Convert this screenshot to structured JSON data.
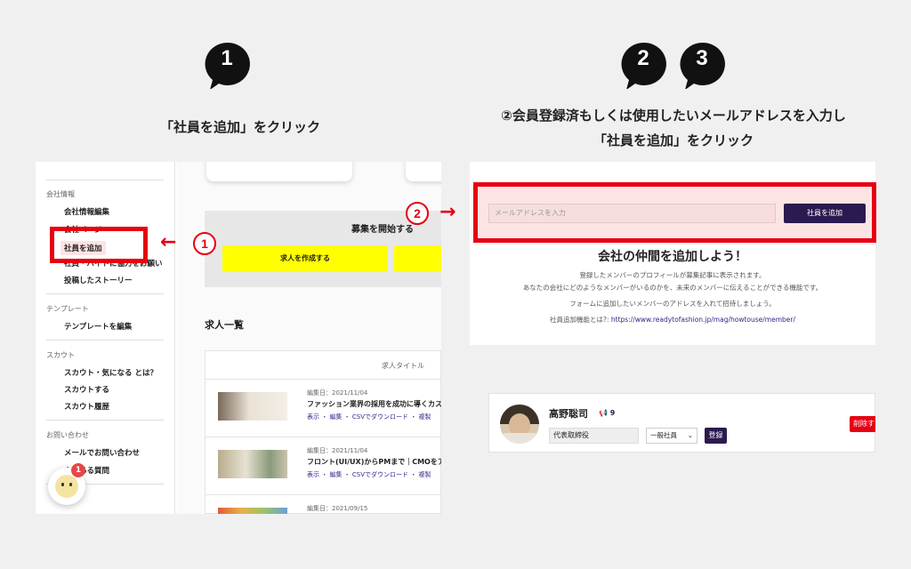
{
  "steps": [
    {
      "number": "1"
    },
    {
      "number": "2"
    },
    {
      "number": "3"
    }
  ],
  "step1_text": "「社員を追加」をクリック",
  "step23_text_line1": "②会員登録済もしくは使用したいメールアドレスを入力し",
  "step23_text_line2": "「社員を追加」をクリック",
  "callouts": {
    "one": "1",
    "two": "2",
    "arrow_left": "←",
    "arrow_right": "→"
  },
  "sidebar": {
    "sections": [
      {
        "label": "会社情報"
      },
      {
        "label": "テンプレート"
      },
      {
        "label": "スカウト"
      },
      {
        "label": "お問い合わせ"
      }
    ],
    "items": [
      {
        "label": "会社情報編集"
      },
      {
        "label": "会社ページ"
      },
      {
        "label": "社員を追加"
      },
      {
        "label": "社員・バイトに協力をお願い"
      },
      {
        "label": "投稿したストーリー"
      },
      {
        "label": "テンプレートを編集"
      },
      {
        "label": "スカウト・気になる とは？"
      },
      {
        "label": "スカウトする"
      },
      {
        "label": "スカウト履歴"
      },
      {
        "label": "メールでお問い合わせ"
      },
      {
        "label": "よくある質問"
      }
    ]
  },
  "main": {
    "recruit_title": "募集を開始する",
    "create_job_button": "求人を作成する",
    "list_title": "求人一覧",
    "list_header": "求人タイトル",
    "rows": [
      {
        "date": "編集日：2021/11/04",
        "title": "ファッション業界の採用を成功に導くカス",
        "actions": "表示 ・ 編集 ・ CSVでダウンロード ・ 複製"
      },
      {
        "date": "編集日：2021/11/04",
        "title": "フロント(UI/UX)からPMまで｜CMOをア",
        "actions": "表示 ・ 編集 ・ CSVでダウンロード ・ 複製"
      },
      {
        "date": "編集日：2021/09/15",
        "title": "",
        "actions": ""
      }
    ]
  },
  "chat": {
    "badge": "1"
  },
  "add_member": {
    "email_placeholder": "メールアドレスを入力",
    "add_button": "社員を追加",
    "promo_title": "会社の仲間を追加しよう！",
    "promo_line1": "登録したメンバーのプロフィールが募集記事に表示されます。",
    "promo_line2": "あなたの会社にどのようなメンバーがいるのかを、未来のメンバーに伝えることができる機能です。",
    "promo_line3": "フォームに追加したいメンバーのアドレスを入れて招待しましょう。",
    "promo_link_prefix": "社員追加機能とは?: ",
    "promo_link": "https://www.readytofashion.jp/mag/howtouse/member/"
  },
  "member": {
    "name": "高野聡司",
    "count": "9",
    "role": "代表取締役",
    "type_select": "一般社員",
    "register_button": "登録",
    "delete_button": "削除す"
  },
  "colors": {
    "accent_red": "#e60012",
    "navy": "#2b1a4f",
    "yellow": "#ffff00",
    "link": "#2d2a8a"
  }
}
